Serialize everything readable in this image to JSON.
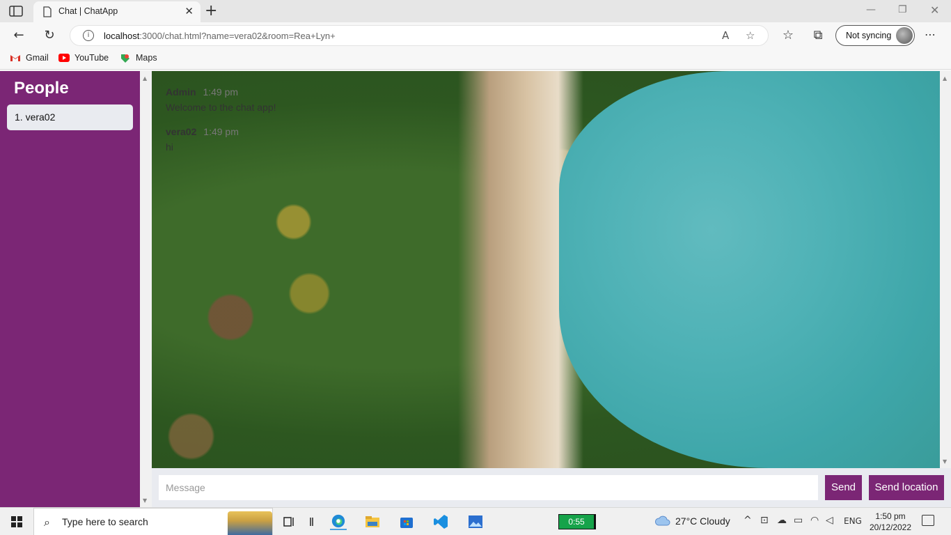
{
  "browser": {
    "tab_title": "Chat | ChatApp",
    "url_host": "localhost",
    "url_rest": ":3000/chat.html?name=vera02&room=Rea+Lyn+",
    "profile_label": "Not syncing",
    "bookmarks": [
      {
        "label": "Gmail",
        "icon": "gmail-icon"
      },
      {
        "label": "YouTube",
        "icon": "youtube-icon"
      },
      {
        "label": "Maps",
        "icon": "maps-icon"
      }
    ]
  },
  "sidebar": {
    "title": "People",
    "users": [
      "1. vera02"
    ]
  },
  "messages": [
    {
      "name": "Admin",
      "time": "1:49 pm",
      "text": "Welcome to the chat app!"
    },
    {
      "name": "vera02",
      "time": "1:49 pm",
      "text": "hi"
    }
  ],
  "composer": {
    "placeholder": "Message",
    "send_label": "Send",
    "location_label": "Send location"
  },
  "taskbar": {
    "search_placeholder": "Type here to search",
    "timer": "0:55",
    "weather": "27°C  Cloudy",
    "language": "ENG",
    "time": "1:50 pm",
    "date": "20/12/2022"
  },
  "colors": {
    "accent": "#7b2675",
    "sidebar_user_bg": "#e9ebf0"
  }
}
